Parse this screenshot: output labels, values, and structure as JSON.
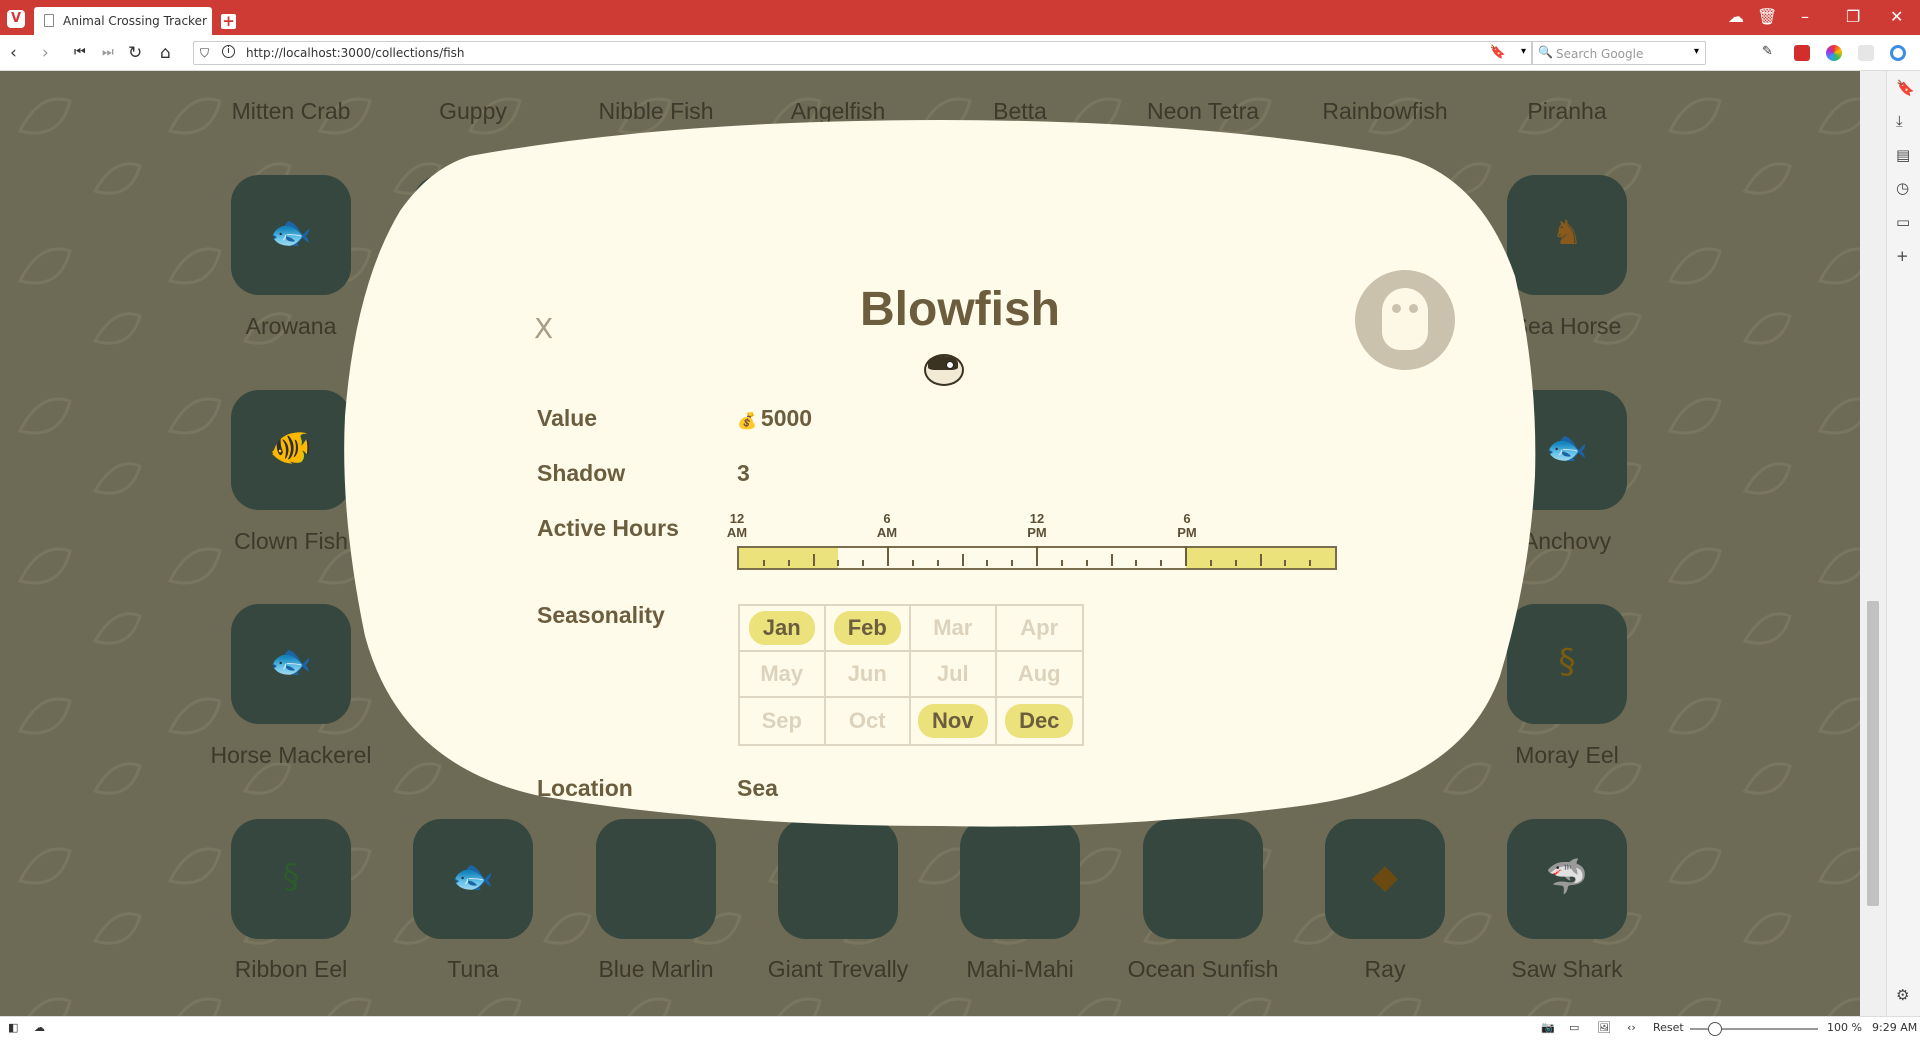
{
  "browser": {
    "tab_title": "Animal Crossing Tracker",
    "url": "http://localhost:3000/collections/fish",
    "search_placeholder": "Search Google",
    "status": {
      "reset_label": "Reset",
      "zoom": "100 %",
      "time": "9:29 AM"
    }
  },
  "fish_grid": {
    "row1_labels": [
      "Mitten Crab",
      "Guppy",
      "Nibble Fish",
      "Angelfish",
      "Betta",
      "Neon Tetra",
      "Rainbowfish",
      "Piranha"
    ],
    "row2_labels": [
      "Arowana",
      "Sea Horse"
    ],
    "row3_labels": [
      "Clown Fish",
      "Anchovy"
    ],
    "row4_labels": [
      "Horse Mackerel",
      "Moray Eel"
    ],
    "row5_labels": [
      "Ribbon Eel",
      "Tuna",
      "Blue Marlin",
      "Giant Trevally",
      "Mahi-Mahi",
      "Ocean Sunfish",
      "Ray",
      "Saw Shark"
    ]
  },
  "modal": {
    "title": "Blowfish",
    "close_label": "X",
    "value_label": "Value",
    "value": "5000",
    "shadow_label": "Shadow",
    "shadow": "3",
    "hours_label": "Active Hours",
    "hour_ticks": [
      {
        "top": "12",
        "bottom": "AM"
      },
      {
        "top": "6",
        "bottom": "AM"
      },
      {
        "top": "12",
        "bottom": "PM"
      },
      {
        "top": "6",
        "bottom": "PM"
      }
    ],
    "active_hours": [
      [
        0,
        4
      ],
      [
        18,
        24
      ]
    ],
    "seasonality_label": "Seasonality",
    "months": [
      {
        "name": "Jan",
        "active": true
      },
      {
        "name": "Feb",
        "active": true
      },
      {
        "name": "Mar",
        "active": false
      },
      {
        "name": "Apr",
        "active": false
      },
      {
        "name": "May",
        "active": false
      },
      {
        "name": "Jun",
        "active": false
      },
      {
        "name": "Jul",
        "active": false
      },
      {
        "name": "Aug",
        "active": false
      },
      {
        "name": "Sep",
        "active": false
      },
      {
        "name": "Oct",
        "active": false
      },
      {
        "name": "Nov",
        "active": true
      },
      {
        "name": "Dec",
        "active": true
      }
    ],
    "location_label": "Location",
    "location": "Sea"
  }
}
